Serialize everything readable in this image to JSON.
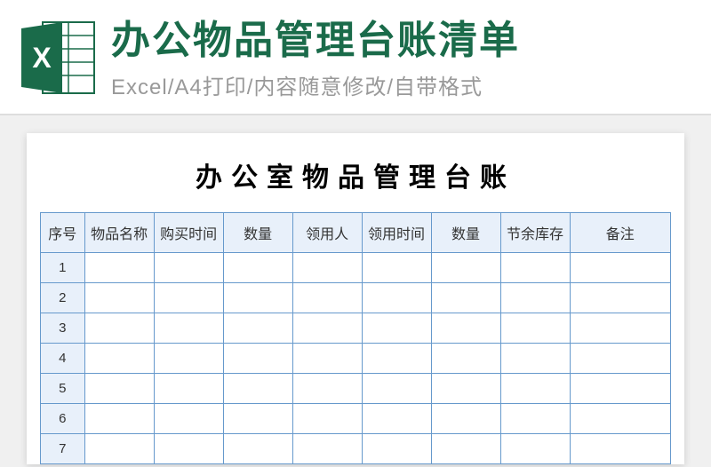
{
  "header": {
    "title": "办公物品管理台账清单",
    "subtitle": "Excel/A4打印/内容随意修改/自带格式",
    "icon_label": "X"
  },
  "sheet": {
    "title": "办公室物品管理台账",
    "columns": [
      "序号",
      "物品名称",
      "购买时间",
      "数量",
      "领用人",
      "领用时间",
      "数量",
      "节余库存",
      "备注"
    ],
    "rows": [
      {
        "num": "1"
      },
      {
        "num": "2"
      },
      {
        "num": "3"
      },
      {
        "num": "4"
      },
      {
        "num": "5"
      },
      {
        "num": "6"
      },
      {
        "num": "7"
      }
    ]
  }
}
